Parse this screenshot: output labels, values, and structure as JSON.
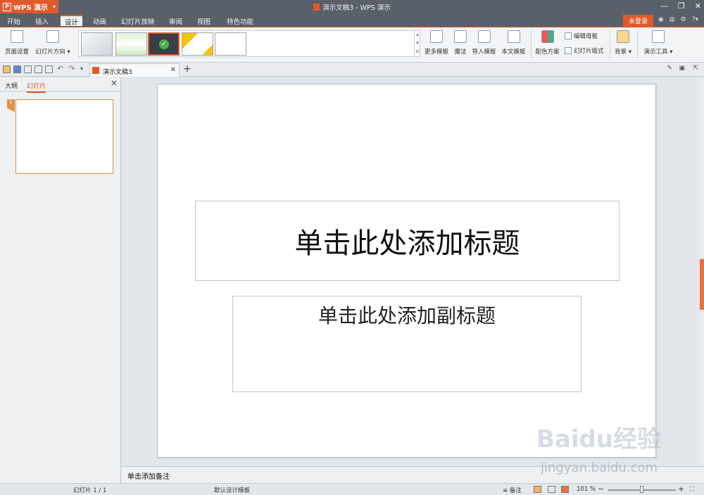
{
  "app": {
    "name": "WPS 演示",
    "window_title": "演示文稿3 - WPS 演示"
  },
  "menu": {
    "tabs": [
      "开始",
      "插入",
      "设计",
      "动画",
      "幻灯片放映",
      "审阅",
      "视图",
      "特色功能"
    ],
    "active": "设计",
    "login_label": "未登录"
  },
  "ribbon": {
    "page_setup": "页面设置",
    "slide_orientation": "幻灯片方向",
    "more_templates": "更多模板",
    "magic": "魔法",
    "import_template": "导入模板",
    "this_template": "本文模板",
    "color_scheme": "配色方案",
    "edit_master": "编辑母板",
    "slide_layout": "幻灯片版式",
    "background": "背景",
    "presentation_tools": "演示工具"
  },
  "document_tab": {
    "label": "演示文稿3"
  },
  "left_pane": {
    "tabs": [
      "大纲",
      "幻灯片"
    ],
    "active": "幻灯片",
    "slide_number": "1"
  },
  "slide": {
    "title_placeholder": "单击此处添加标题",
    "subtitle_placeholder": "单击此处添加副标题"
  },
  "notes": {
    "placeholder": "单击添加备注"
  },
  "statusbar": {
    "slide_counter": "幻灯片 1 / 1",
    "template_name": "默认设计模板",
    "notes_label": "备注",
    "zoom": "101 %"
  },
  "watermark": {
    "brand": "Baidu经验",
    "url": "jingyan.baidu.com"
  },
  "colors": {
    "accent": "#e0592a",
    "titlebar": "#5a6069"
  }
}
